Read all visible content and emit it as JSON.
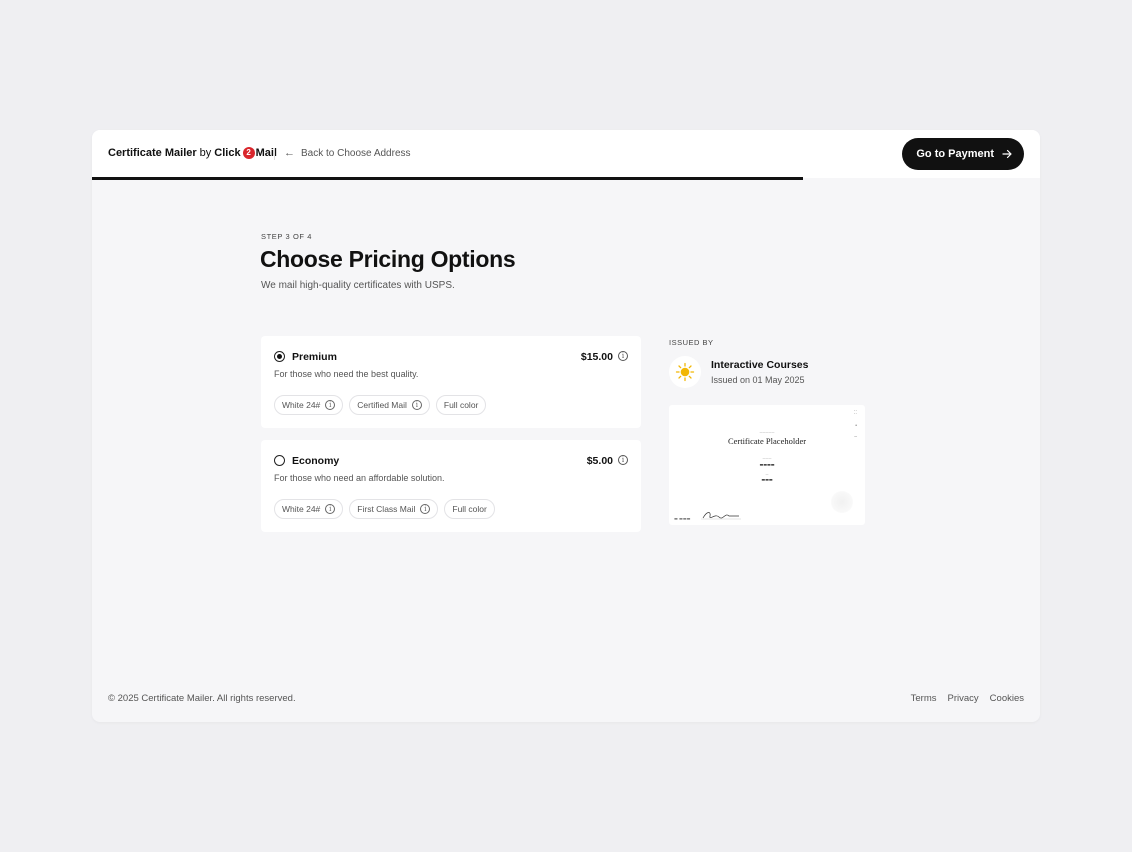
{
  "header": {
    "brand_name": "Certificate Mailer",
    "brand_by": "by",
    "brand_click": "Click",
    "brand_two": "2",
    "brand_mail": "Mail",
    "back_label": "Back to Choose Address",
    "pay_label": "Go to Payment",
    "progress_fraction": 0.75
  },
  "page": {
    "step_label": "STEP 3 OF 4",
    "title": "Choose Pricing Options",
    "subtitle": "We mail high-quality certificates with USPS."
  },
  "options": [
    {
      "name": "Premium",
      "price": "$15.00",
      "description": "For those who need the best quality.",
      "selected": true,
      "chips": [
        "White 24#",
        "Certified Mail",
        "Full color"
      ]
    },
    {
      "name": "Economy",
      "price": "$5.00",
      "description": "For those who need an affordable solution.",
      "selected": false,
      "chips": [
        "White 24#",
        "First Class Mail",
        "Full color"
      ]
    }
  ],
  "issuer": {
    "label": "ISSUED BY",
    "name": "Interactive Courses",
    "date": "Issued on 01 May 2025"
  },
  "certificate": {
    "heading": "Certificate Placeholder"
  },
  "footer": {
    "copyright": "© 2025 Certificate Mailer. All rights reserved.",
    "links": [
      "Terms",
      "Privacy",
      "Cookies"
    ]
  },
  "colors": {
    "accent": "#111111",
    "brand_red": "#d9262c",
    "sun": "#f2b705"
  }
}
